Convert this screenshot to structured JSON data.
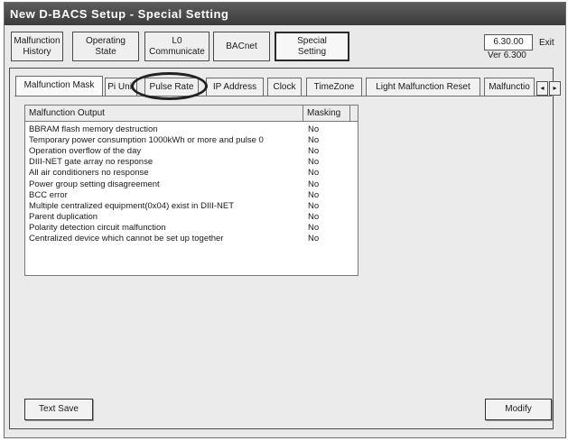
{
  "window": {
    "title": "New D-BACS Setup - Special Setting"
  },
  "top_buttons": [
    "Malfunction\nHistory",
    "Operating\nState",
    "L0\nCommunicate",
    "BACnet",
    "Special\nSetting"
  ],
  "version": {
    "value": "6.30.00",
    "label": "Ver 6.300"
  },
  "exit_label": "Exit",
  "tabs": [
    "Malfunction Mask",
    "Pi Unit",
    "Pulse Rate",
    "IP Address",
    "Clock",
    "TimeZone",
    "Light Malfunction Reset",
    "Malfunctio"
  ],
  "tab_scroll": {
    "left_icon": "arrow-left-icon",
    "right_icon": "arrow-right-icon",
    "left": "◂",
    "right": "▸"
  },
  "table": {
    "headers": [
      "Malfunction Output",
      "Masking"
    ],
    "rows": [
      [
        "BBRAM flash memory destruction",
        "No"
      ],
      [
        "Temporary power consumption 1000kWh or more and pulse 0",
        "No"
      ],
      [
        "Operation overflow of the day",
        "No"
      ],
      [
        "DIII-NET gate array no response",
        "No"
      ],
      [
        "All air conditioners no response",
        "No"
      ],
      [
        "Power group setting disagreement",
        "No"
      ],
      [
        "BCC error",
        "No"
      ],
      [
        "Multiple centralized equipment(0x04) exist in DIII-NET",
        "No"
      ],
      [
        "Parent duplication",
        "No"
      ],
      [
        "Polarity detection circuit malfunction",
        "No"
      ],
      [
        "Centralized device which cannot be set up together",
        "No"
      ]
    ]
  },
  "buttons": {
    "text_save": "Text Save",
    "modify": "Modify"
  }
}
